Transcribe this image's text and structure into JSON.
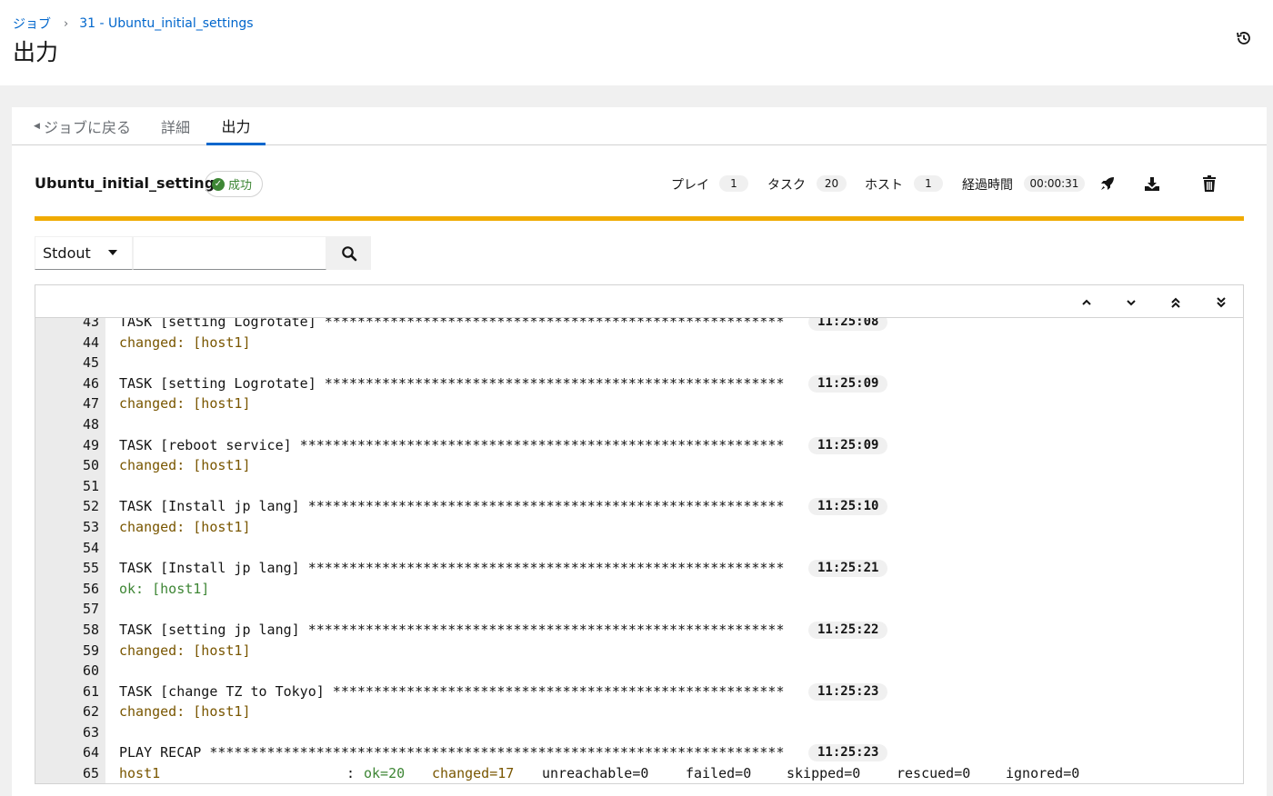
{
  "breadcrumb": {
    "jobs": "ジョブ",
    "current": "31 - Ubuntu_initial_settings"
  },
  "page_title": "出力",
  "tabs": {
    "back": "ジョブに戻る",
    "details": "詳細",
    "output": "出力"
  },
  "job": {
    "name": "Ubuntu_initial_settings",
    "status": "成功",
    "plays_label": "プレイ",
    "plays": "1",
    "tasks_label": "タスク",
    "tasks": "20",
    "hosts_label": "ホスト",
    "hosts": "1",
    "elapsed_label": "経過時間",
    "elapsed": "00:00:31"
  },
  "search": {
    "type": "Stdout",
    "value": ""
  },
  "colors": {
    "progress": "#f0ab00",
    "changed": "#795600",
    "ok": "#3e8635",
    "link": "#0066cc"
  },
  "icons": [
    "history-icon",
    "rocket-icon",
    "download-icon",
    "trash-icon",
    "search-icon",
    "angle-up-icon",
    "angle-down-icon",
    "angle-double-up-icon",
    "angle-double-down-icon"
  ],
  "output": {
    "lines": [
      {
        "n": "43",
        "text": "TASK [setting Logrotate] ********************************************************",
        "ts": "11:25:08",
        "kind": "task"
      },
      {
        "n": "44",
        "text": "changed: [host1]",
        "kind": "changed"
      },
      {
        "n": "45",
        "text": "",
        "kind": "plain"
      },
      {
        "n": "46",
        "text": "TASK [setting Logrotate] ********************************************************",
        "ts": "11:25:09",
        "kind": "task"
      },
      {
        "n": "47",
        "text": "changed: [host1]",
        "kind": "changed"
      },
      {
        "n": "48",
        "text": "",
        "kind": "plain"
      },
      {
        "n": "49",
        "text": "TASK [reboot service] ***********************************************************",
        "ts": "11:25:09",
        "kind": "task"
      },
      {
        "n": "50",
        "text": "changed: [host1]",
        "kind": "changed"
      },
      {
        "n": "51",
        "text": "",
        "kind": "plain"
      },
      {
        "n": "52",
        "text": "TASK [Install jp lang] **********************************************************",
        "ts": "11:25:10",
        "kind": "task"
      },
      {
        "n": "53",
        "text": "changed: [host1]",
        "kind": "changed"
      },
      {
        "n": "54",
        "text": "",
        "kind": "plain"
      },
      {
        "n": "55",
        "text": "TASK [Install jp lang] **********************************************************",
        "ts": "11:25:21",
        "kind": "task"
      },
      {
        "n": "56",
        "text": "ok: [host1]",
        "kind": "ok"
      },
      {
        "n": "57",
        "text": "",
        "kind": "plain"
      },
      {
        "n": "58",
        "text": "TASK [setting jp lang] **********************************************************",
        "ts": "11:25:22",
        "kind": "task"
      },
      {
        "n": "59",
        "text": "changed: [host1]",
        "kind": "changed"
      },
      {
        "n": "60",
        "text": "",
        "kind": "plain"
      },
      {
        "n": "61",
        "text": "TASK [change TZ to Tokyo] *******************************************************",
        "ts": "11:25:23",
        "kind": "task"
      },
      {
        "n": "62",
        "text": "changed: [host1]",
        "kind": "changed"
      },
      {
        "n": "63",
        "text": "",
        "kind": "plain"
      },
      {
        "n": "64",
        "text": "PLAY RECAP **********************************************************************",
        "ts": "11:25:23",
        "kind": "task"
      }
    ],
    "recap": {
      "n": "65",
      "host": "host1",
      "colon": ":",
      "ok": "ok=20",
      "changed": "changed=17",
      "unreachable": "unreachable=0",
      "failed": "failed=0",
      "skipped": "skipped=0",
      "rescued": "rescued=0",
      "ignored": "ignored=0"
    }
  }
}
